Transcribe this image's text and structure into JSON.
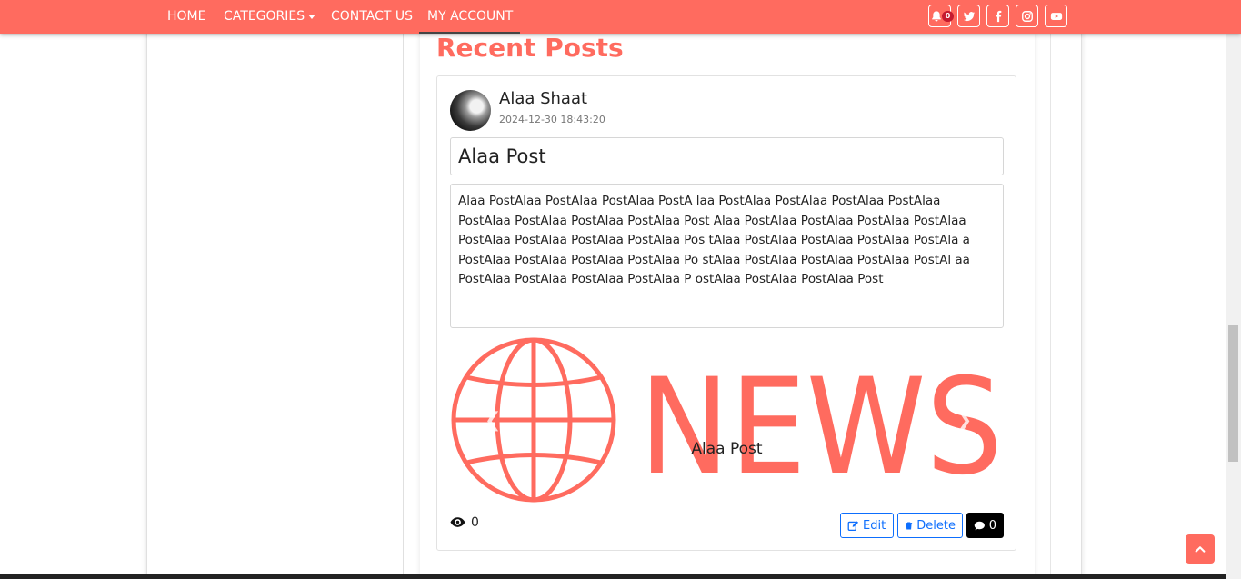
{
  "nav": {
    "links": [
      "HOME",
      "CATEGORIES",
      "CONTACT US",
      "MY ACCOUNT"
    ],
    "active": "MY ACCOUNT",
    "notification_count": "0",
    "icons": [
      "bell-icon",
      "twitter-icon",
      "facebook-icon",
      "instagram-icon",
      "youtube-icon"
    ]
  },
  "section": {
    "title": "Recent Posts"
  },
  "post": {
    "author": "Alaa Shaat",
    "date": "2024-12-30 18:43:20",
    "title": "Alaa Post",
    "body": "Alaa PostAlaa PostAlaa PostAlaa PostA laa PostAlaa PostAlaa PostAlaa PostAlaa PostAlaa PostAlaa PostAlaa PostAlaa Post Alaa PostAlaa PostAlaa PostAlaa PostAlaa PostAlaa PostAlaa PostAlaa PostAlaa Pos tAlaa PostAlaa PostAlaa PostAlaa PostAla a PostAlaa PostAlaa PostAlaa PostAlaa Po stAlaa PostAlaa PostAlaa PostAlaa PostAl aa PostAlaa PostAlaa PostAlaa PostAlaa P ostAlaa PostAlaa PostAlaa Post",
    "image_text": "NEWS",
    "caption": "Alaa Post",
    "views": "0",
    "edit_label": "Edit",
    "delete_label": "Delete",
    "comments": "0"
  },
  "colors": {
    "brand": "#ff6b5f",
    "link": "#0d6efd",
    "badge": "#c51b2f"
  }
}
